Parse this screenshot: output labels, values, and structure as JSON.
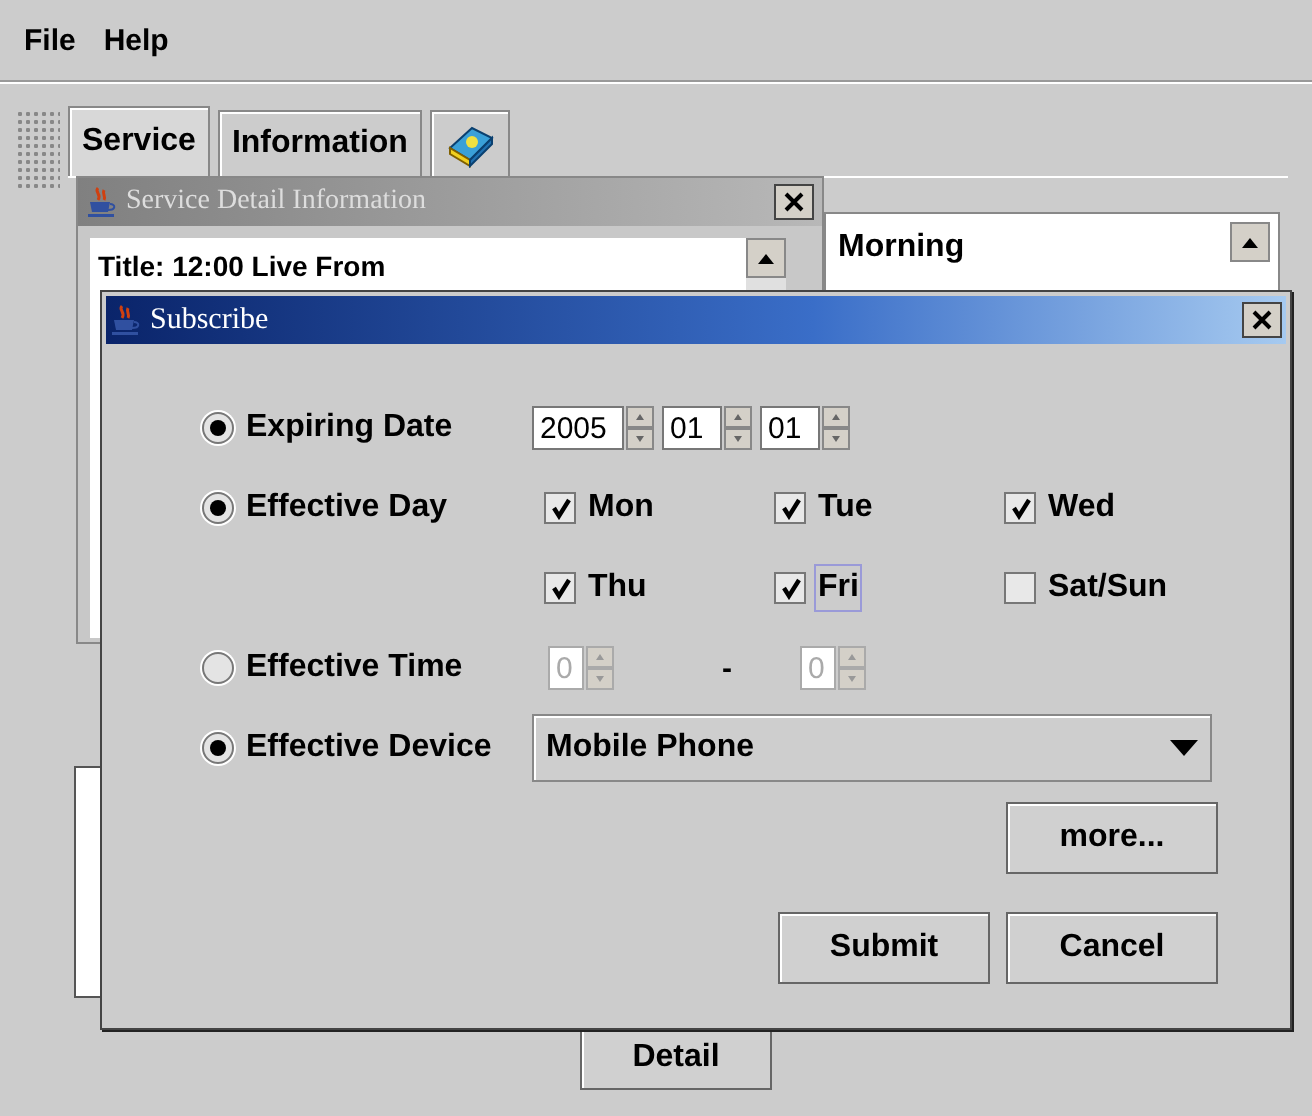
{
  "menu": [
    "File",
    "Help"
  ],
  "tabs": [
    {
      "kind": "text",
      "label": "Service",
      "selected": true
    },
    {
      "kind": "text",
      "label": "Information",
      "selected": false
    },
    {
      "kind": "icon",
      "selected": false
    }
  ],
  "detail_window": {
    "title": "Service Detail Information",
    "text": "Title: 12:00 Live From"
  },
  "time_list": {
    "items": [
      "Morning"
    ]
  },
  "detail_button": "Detail",
  "dialog": {
    "title": "Subscribe",
    "options": [
      {
        "kind": "date",
        "label": "Expiring Date",
        "selected": true,
        "fields": [
          "2005",
          "01",
          "01"
        ]
      },
      {
        "kind": "days",
        "label": "Effective Day",
        "selected": true,
        "days": [
          {
            "label": "Mon",
            "checked": true,
            "focused": false
          },
          {
            "label": "Tue",
            "checked": true,
            "focused": false
          },
          {
            "label": "Wed",
            "checked": true,
            "focused": false
          },
          {
            "label": "Thu",
            "checked": true,
            "focused": false
          },
          {
            "label": "Fri",
            "checked": true,
            "focused": true
          },
          {
            "label": "Sat/Sun",
            "checked": false,
            "focused": false
          }
        ]
      },
      {
        "kind": "time",
        "label": "Effective Time",
        "selected": false,
        "disabled": true,
        "fields": [
          "0",
          "0"
        ],
        "separator": "-"
      },
      {
        "kind": "device",
        "label": "Effective Device",
        "selected": true,
        "value": "Mobile Phone"
      }
    ],
    "more_button": "more...",
    "buttons": [
      "Submit",
      "Cancel"
    ]
  }
}
